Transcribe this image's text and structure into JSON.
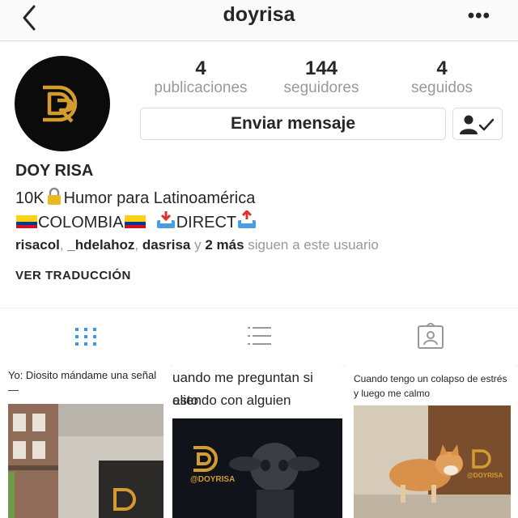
{
  "header": {
    "title": "doyrisa",
    "more": "•••"
  },
  "profile": {
    "stats": [
      {
        "value": "4",
        "label": "publicaciones"
      },
      {
        "value": "144",
        "label": "seguidores"
      },
      {
        "value": "4",
        "label": "seguidos"
      }
    ],
    "message_button": "Enviar mensaje"
  },
  "bio": {
    "name": "DOY RISA",
    "line1_a": "10K",
    "line1_b": "Humor para Latinoamérica",
    "line2_a": "COLOMBIA",
    "line2_b": "DIRECT",
    "followed_by": {
      "user1": "risacol",
      "sep1": ", ",
      "user2": "_hdelahoz",
      "sep2": ", ",
      "user3": "dasrisa",
      "and": " y ",
      "more": "2 más",
      "suffix": " siguen a este usuario"
    },
    "translate": "VER TRADUCCIÓN"
  },
  "posts": [
    {
      "caption": "Yo: Diosito mándame una señal",
      "caption2": "—",
      "watermark": ""
    },
    {
      "caption": "uando me preguntan si esto",
      "caption2": "aliendo con alguien",
      "watermark": "@DOYRISA"
    },
    {
      "caption": "Cuando tengo un colapso de estrés y luego me calmo",
      "caption2": "",
      "watermark": "@DOYRISA"
    }
  ],
  "colors": {
    "accent": "#3897f0",
    "muted": "#999999",
    "brand_gold": "#d49b2f"
  }
}
